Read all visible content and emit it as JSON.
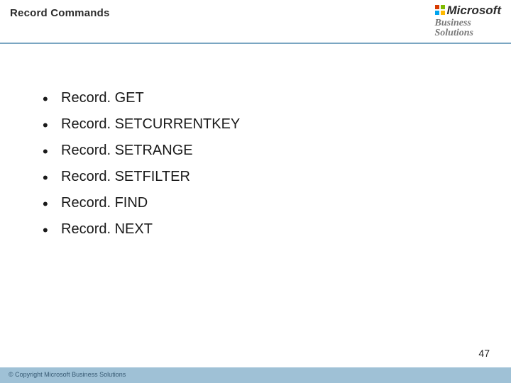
{
  "header": {
    "title": "Record Commands",
    "brand": {
      "line1": "Microsoft",
      "line2": "Business",
      "line3": "Solutions"
    }
  },
  "bullets": [
    "Record. GET",
    "Record. SETCURRENTKEY",
    "Record. SETRANGE",
    "Record. SETFILTER",
    "Record. FIND",
    "Record. NEXT"
  ],
  "page_number": "47",
  "footer": {
    "copyright": "© Copyright Microsoft Business Solutions"
  }
}
